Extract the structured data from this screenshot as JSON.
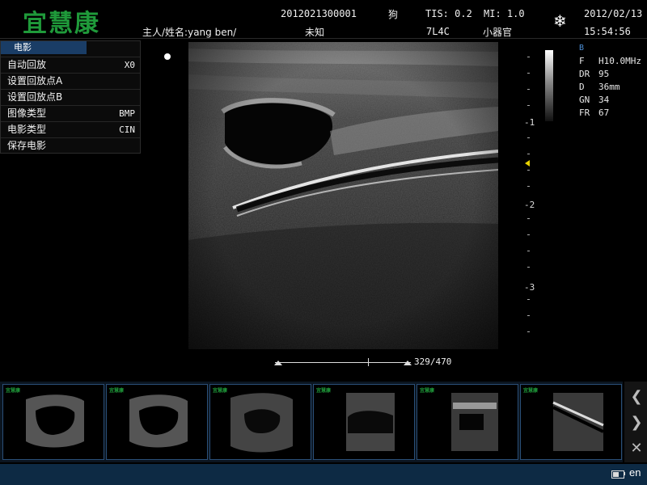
{
  "header": {
    "logo": "宜慧康",
    "patient_id": "2012021300001",
    "species": "狗",
    "tis": "TIS: 0.2",
    "mi": "MI: 1.0",
    "date": "2012/02/13",
    "owner_name": "主人/姓名:yang ben/",
    "unknown": "未知",
    "probe": "7L4C",
    "exam": "小器官",
    "time": "15:54:56",
    "freeze_icon": "snowflake-icon"
  },
  "cine_menu": {
    "title": "电影",
    "items": [
      {
        "label": "自动回放",
        "value": "X0"
      },
      {
        "label": "设置回放点A",
        "value": ""
      },
      {
        "label": "设置回放点B",
        "value": ""
      },
      {
        "label": "图像类型",
        "value": "BMP"
      },
      {
        "label": "电影类型",
        "value": "CIN"
      },
      {
        "label": "保存电影",
        "value": ""
      }
    ]
  },
  "depth_scale": {
    "labels": [
      "-1",
      "-2",
      "-3"
    ]
  },
  "params": {
    "mode": "B",
    "rows": [
      {
        "key": "F",
        "val": "H10.0MHz"
      },
      {
        "key": "DR",
        "val": "95"
      },
      {
        "key": "D",
        "val": "36mm"
      },
      {
        "key": "GN",
        "val": "34"
      },
      {
        "key": "FR",
        "val": "67"
      }
    ]
  },
  "cine": {
    "counter": "329/470",
    "current_frame": 329,
    "total_frames": 470
  },
  "thumbnails": {
    "count": 6,
    "logo_text": "宜慧康"
  },
  "nav": {
    "prev_icon": "chevron-left-icon",
    "next_icon": "chevron-right-icon",
    "delete_icon": "close-icon"
  },
  "status": {
    "lang": "en",
    "battery_icon": "battery-icon"
  }
}
